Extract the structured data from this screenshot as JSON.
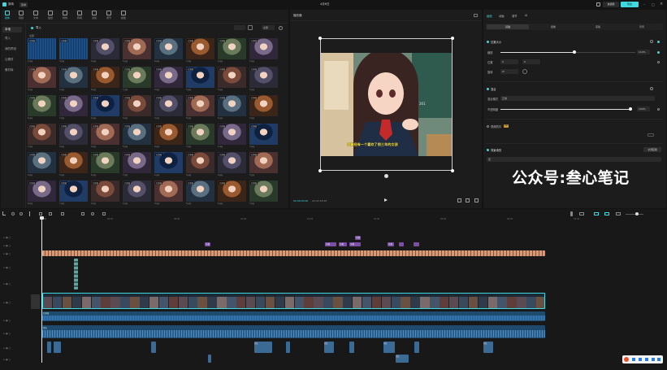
{
  "app": {
    "title_center": "4月6日",
    "title_left_badges": [
      "剪映",
      "菜单"
    ],
    "title_right": [
      "导出",
      "快捷键"
    ]
  },
  "toolbar": {
    "items": [
      {
        "label": "媒体",
        "active": true
      },
      {
        "label": "音频",
        "active": false
      },
      {
        "label": "文本",
        "active": false
      },
      {
        "label": "贴纸",
        "active": false
      },
      {
        "label": "特效",
        "active": false
      },
      {
        "label": "转场",
        "active": false
      },
      {
        "label": "滤镜",
        "active": false
      },
      {
        "label": "调节",
        "active": false
      },
      {
        "label": "模板",
        "active": false
      }
    ]
  },
  "sidebar": {
    "items": [
      {
        "label": "本地",
        "active": true
      },
      {
        "label": "导入",
        "active": false
      },
      {
        "label": "我的预设",
        "active": false
      },
      {
        "label": "云素材",
        "active": false
      },
      {
        "label": "素材库",
        "active": false
      }
    ]
  },
  "media": {
    "header_label": "导入",
    "sort_label": "全部",
    "section_label": "全部",
    "thumb_labels": [
      "已添加 已添加",
      "已添加",
      "2.jpg",
      "3.jpg",
      "4.jpg",
      "5.jpg",
      "6.jpg",
      "7.jpg"
    ]
  },
  "player": {
    "title": "播放器",
    "subtitle": "我曾经有一个喜欢了很三年的女孩",
    "time_current": "00:00:00:00",
    "time_total": "00:02:48:28",
    "chalk_number": "261"
  },
  "inspector": {
    "tabs": [
      "画面",
      "动画",
      "调节",
      "AI"
    ],
    "subtabs": [
      "基础",
      "抠像",
      "蒙版",
      "背景"
    ],
    "section_position": "位置大小",
    "scale_label": "缩放",
    "scale_value": "110%",
    "pos_label": "位置",
    "pos_x": "0",
    "pos_y": "0",
    "rotate_label": "旋转",
    "rotate_value": "0°",
    "section_blend": "混合",
    "blend_mode_label": "混合模式",
    "blend_mode_value": "正常",
    "opacity_label": "不透明度",
    "opacity_value": "100%",
    "opacity_level": 1.0,
    "scale_level": 0.55,
    "stabilize_label": "视频防抖",
    "stabilize_tag": "VIP",
    "bg_fill_label": "背景填充",
    "bg_fill_button": "全部应用",
    "bg_fill_value": "无"
  },
  "watermark": "公众号:叁心笔记",
  "timeline": {
    "ruler_labels": [
      "00:00",
      "00:20",
      "00:40",
      "01:00",
      "01:20",
      "01:40",
      "02:00",
      "02:20",
      "02:40"
    ],
    "text_clips": [
      "字幕",
      "字幕",
      "字幕",
      "字幕",
      "字幕",
      "字幕"
    ],
    "main_track_label": "已添加",
    "audio_labels": [
      "音频",
      "音乐"
    ],
    "bottom_clip_labels": [
      "音效",
      "音效",
      "音效",
      "音效",
      "音效",
      "音效",
      "音效",
      "音效"
    ]
  },
  "colors": {
    "accent": "#3fd7e0",
    "audio_blue": "#2b5d86",
    "text_clip_purple": "#7b4fa6",
    "subtitle_track": "#c98a6a"
  }
}
